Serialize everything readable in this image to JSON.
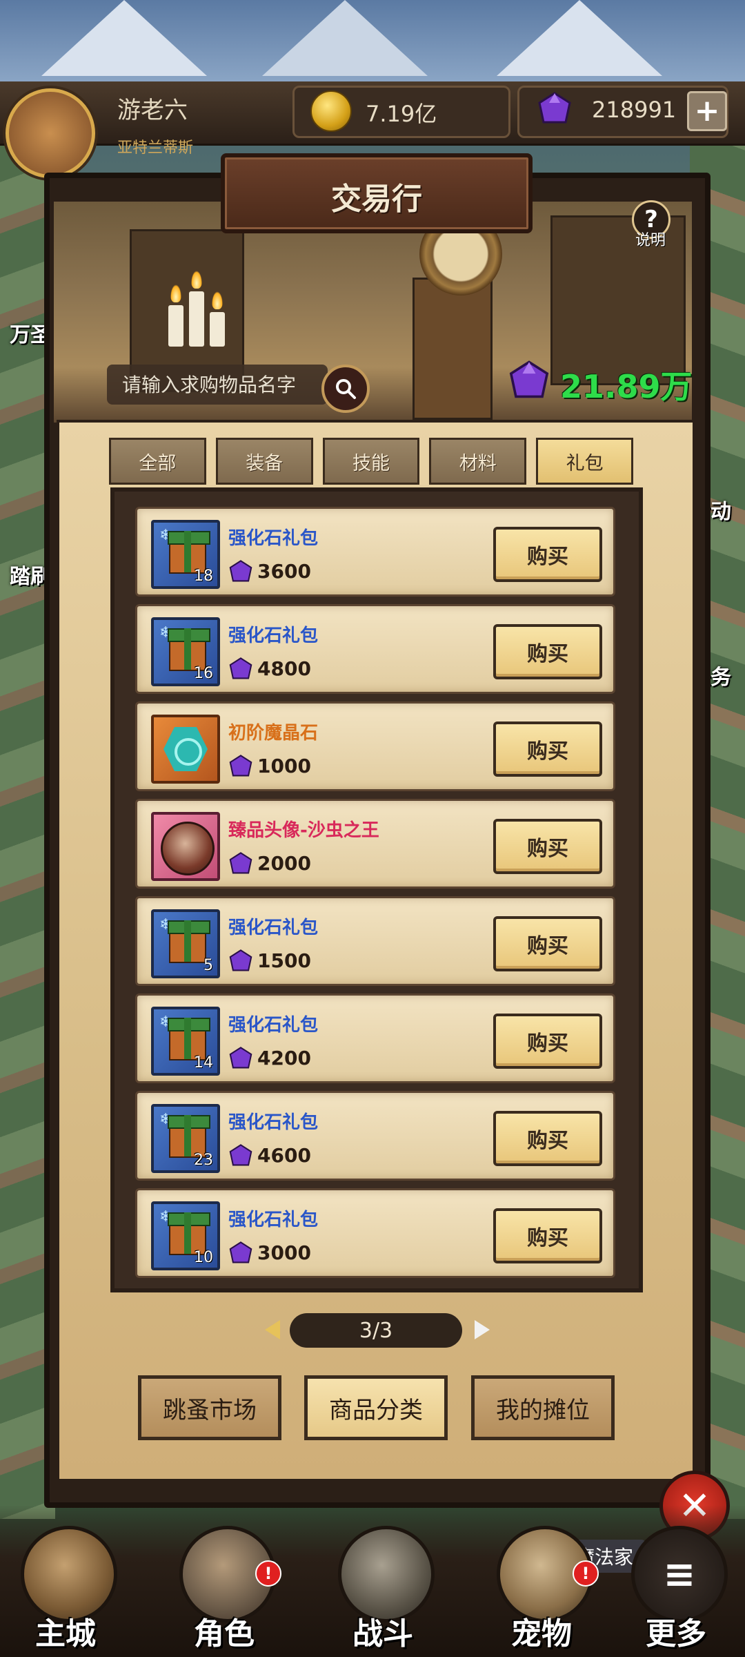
{
  "header": {
    "player_name": "游老六",
    "subtitle": "亚特兰蒂斯",
    "gold": "7.19亿",
    "gems": "218991",
    "plus_label": "+"
  },
  "panel": {
    "title": "交易行",
    "help_label": "说明",
    "search_placeholder": "请输入求购物品名字",
    "gem_balance": "21.89万"
  },
  "tabs": [
    {
      "label": "全部"
    },
    {
      "label": "装备"
    },
    {
      "label": "技能"
    },
    {
      "label": "材料"
    },
    {
      "label": "礼包"
    }
  ],
  "items": [
    {
      "name": "强化石礼包",
      "qty": "18",
      "price": "3600",
      "buy": "购买"
    },
    {
      "name": "强化石礼包",
      "qty": "16",
      "price": "4800",
      "buy": "购买"
    },
    {
      "name": "初阶魔晶石",
      "qty": "",
      "price": "1000",
      "buy": "购买"
    },
    {
      "name": "臻品头像-沙虫之王",
      "qty": "",
      "price": "2000",
      "buy": "购买"
    },
    {
      "name": "强化石礼包",
      "qty": "5",
      "price": "1500",
      "buy": "购买"
    },
    {
      "name": "强化石礼包",
      "qty": "14",
      "price": "4200",
      "buy": "购买"
    },
    {
      "name": "强化石礼包",
      "qty": "23",
      "price": "4600",
      "buy": "购买"
    },
    {
      "name": "强化石礼包",
      "qty": "10",
      "price": "3000",
      "buy": "购买"
    }
  ],
  "pager": {
    "text": "3/3"
  },
  "bottom_buttons": [
    {
      "label": "跳蚤市场"
    },
    {
      "label": "商品分类"
    },
    {
      "label": "我的摊位"
    }
  ],
  "close_label": "✕",
  "side_labels": {
    "left1": "万圣",
    "left2": "踏刷",
    "right1": "活动",
    "right2": "任务"
  },
  "magic_label": "魔法家",
  "nav": [
    {
      "label": "主城"
    },
    {
      "label": "角色"
    },
    {
      "label": "战斗"
    },
    {
      "label": "宠物"
    },
    {
      "label": "更多"
    }
  ],
  "colors": {
    "gem_green": "#2edc4a",
    "blue_name": "#2a56c8",
    "orange_name": "#d8701a",
    "pink_name": "#d8285a"
  }
}
